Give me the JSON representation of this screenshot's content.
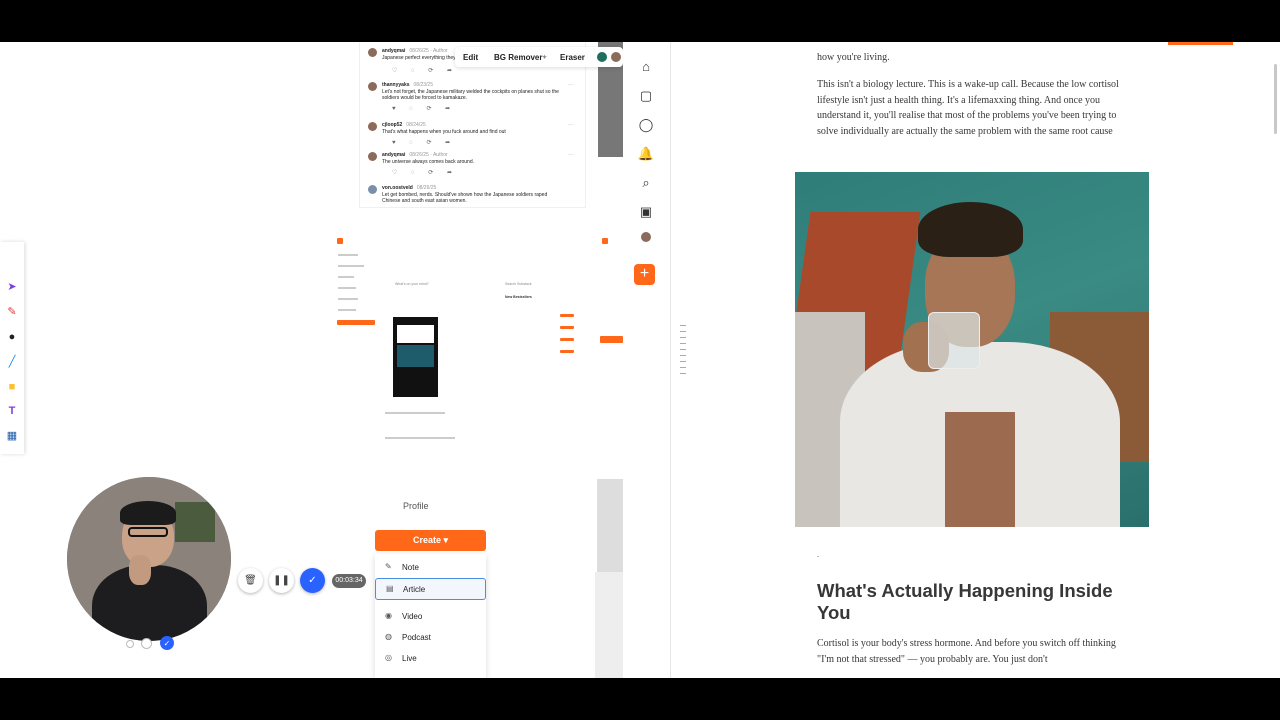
{
  "edit_toolbar": {
    "edit": "Edit",
    "bg_remover": "BG Remover",
    "eraser": "Eraser"
  },
  "comments": [
    {
      "author": "andyqmai",
      "meta": "08/26/25 · Author",
      "body": "Japanese perfect everything they"
    },
    {
      "author": "thannyyaks",
      "meta": "08/23/25",
      "body": "Let's not forget, the Japanese military welded the cockpits on planes shut so the soldiers would be forced to kamakaze."
    },
    {
      "author": "cjloop52",
      "meta": "08/24/25",
      "body": "That's what happens when you fuck around and find out"
    },
    {
      "author": "andyqmai",
      "meta": "08/26/25 · Author",
      "body": "The universe always comes back around."
    },
    {
      "author": "von.oostveld",
      "meta": "08/26/25",
      "body": "Let get bombed, nerds. Should've shown how the Japanese soldiers raped Chinese and south east asian women."
    }
  ],
  "feed": {
    "search_placeholder": "What's on your mind?",
    "search_label": "Search Substack",
    "sidebar_title": "New Bestsellers"
  },
  "create_menu": {
    "profile": "Profile",
    "button": "Create",
    "items": [
      "Note",
      "Article",
      "Video",
      "Podcast",
      "Live"
    ]
  },
  "recorder": {
    "timer": "00:03:34"
  },
  "article": {
    "p0": "how you're living.",
    "p1": "This isn't a biology lecture. This is a wake-up call. Because the low cortisol lifestyle isn't just a health thing. It's a lifemaxxing thing. And once you understand it, you'll realise that most of the problems you've been trying to solve individually are actually the same problem with the same root cause",
    "heading": "What's Actually Happening Inside You",
    "p2": "Cortisol is your body's stress hormone. And before you switch off thinking \"I'm not that stressed\" — you probably are. You just don't",
    "dot": "."
  },
  "colors": {
    "accent": "#ff6719",
    "select": "#2962ff"
  }
}
